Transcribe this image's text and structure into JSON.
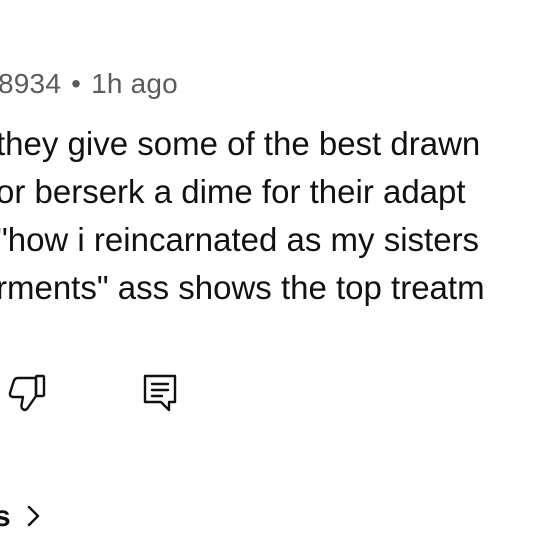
{
  "comment": {
    "author_partial": "8934",
    "separator": "•",
    "timestamp": "1h ago",
    "lines": [
      "they give some of the best drawn",
      " or berserk a dime for their adapt",
      " \"how i reincarnated as my sisters",
      "rments\" ass shows the top treatm"
    ]
  },
  "actions": {
    "dislike_icon": "thumbs-down-icon",
    "reply_icon": "comment-icon"
  },
  "replies": {
    "label_partial": "s",
    "chevron": "chevron-right-icon"
  }
}
